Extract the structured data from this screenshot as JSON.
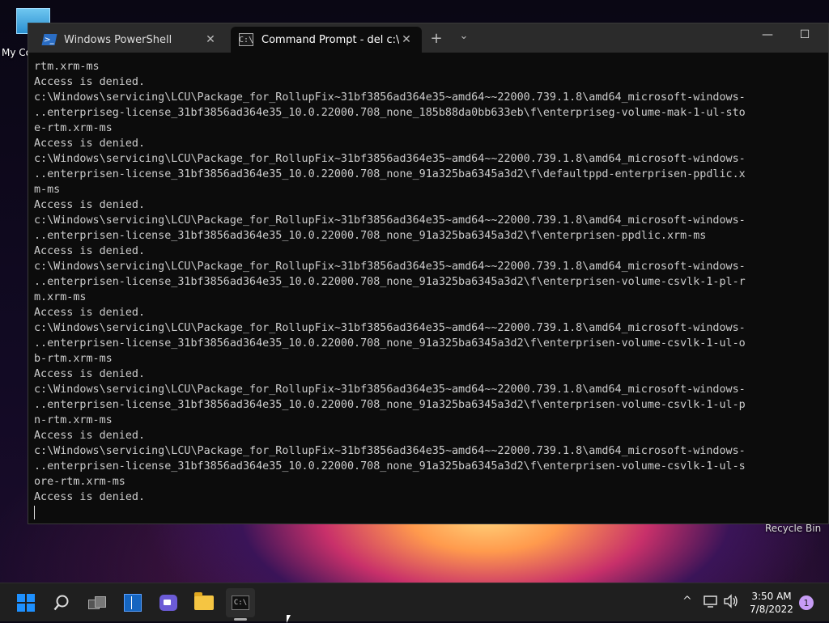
{
  "desktop": {
    "my_computer_label": "My Co",
    "recycle_bin_label": "Recycle Bin"
  },
  "window": {
    "tabs": [
      {
        "label": "Windows PowerShell",
        "icon": "powershell-icon",
        "active": false
      },
      {
        "label": "Command Prompt - del  c:\\ /s /",
        "icon": "cmd-icon",
        "active": true
      }
    ],
    "new_tab_glyph": "+",
    "dropdown_glyph": "⌄",
    "minimize_glyph": "—",
    "maximize_glyph": "☐"
  },
  "console": {
    "lines": [
      "rtm.xrm-ms",
      "Access is denied.",
      "c:\\Windows\\servicing\\LCU\\Package_for_RollupFix~31bf3856ad364e35~amd64~~22000.739.1.8\\amd64_microsoft-windows-",
      "..enterpriseg-license_31bf3856ad364e35_10.0.22000.708_none_185b88da0bb633eb\\f\\enterpriseg-volume-mak-1-ul-sto",
      "e-rtm.xrm-ms",
      "Access is denied.",
      "c:\\Windows\\servicing\\LCU\\Package_for_RollupFix~31bf3856ad364e35~amd64~~22000.739.1.8\\amd64_microsoft-windows-",
      "..enterprisen-license_31bf3856ad364e35_10.0.22000.708_none_91a325ba6345a3d2\\f\\defaultppd-enterprisen-ppdlic.x",
      "m-ms",
      "Access is denied.",
      "c:\\Windows\\servicing\\LCU\\Package_for_RollupFix~31bf3856ad364e35~amd64~~22000.739.1.8\\amd64_microsoft-windows-",
      "..enterprisen-license_31bf3856ad364e35_10.0.22000.708_none_91a325ba6345a3d2\\f\\enterprisen-ppdlic.xrm-ms",
      "Access is denied.",
      "c:\\Windows\\servicing\\LCU\\Package_for_RollupFix~31bf3856ad364e35~amd64~~22000.739.1.8\\amd64_microsoft-windows-",
      "..enterprisen-license_31bf3856ad364e35_10.0.22000.708_none_91a325ba6345a3d2\\f\\enterprisen-volume-csvlk-1-pl-r",
      "m.xrm-ms",
      "Access is denied.",
      "c:\\Windows\\servicing\\LCU\\Package_for_RollupFix~31bf3856ad364e35~amd64~~22000.739.1.8\\amd64_microsoft-windows-",
      "..enterprisen-license_31bf3856ad364e35_10.0.22000.708_none_91a325ba6345a3d2\\f\\enterprisen-volume-csvlk-1-ul-o",
      "b-rtm.xrm-ms",
      "Access is denied.",
      "c:\\Windows\\servicing\\LCU\\Package_for_RollupFix~31bf3856ad364e35~amd64~~22000.739.1.8\\amd64_microsoft-windows-",
      "..enterprisen-license_31bf3856ad364e35_10.0.22000.708_none_91a325ba6345a3d2\\f\\enterprisen-volume-csvlk-1-ul-p",
      "n-rtm.xrm-ms",
      "Access is denied.",
      "c:\\Windows\\servicing\\LCU\\Package_for_RollupFix~31bf3856ad364e35~amd64~~22000.739.1.8\\amd64_microsoft-windows-",
      "..enterprisen-license_31bf3856ad364e35_10.0.22000.708_none_91a325ba6345a3d2\\f\\enterprisen-volume-csvlk-1-ul-s",
      "ore-rtm.xrm-ms",
      "Access is denied."
    ]
  },
  "taskbar": {
    "apps": [
      "start-icon",
      "search-icon",
      "task-view-icon",
      "widgets-icon",
      "teams-chat-icon",
      "file-explorer-icon",
      "terminal-icon"
    ],
    "tray": {
      "time": "3:50 AM",
      "date": "7/8/2022",
      "notification_count": "1"
    }
  },
  "colors": {
    "console_bg": "#0c0c0c",
    "console_fg": "#cccccc",
    "titlebar": "#2b2b2b",
    "taskbar": "#1f1f1f",
    "start_blue": "#1e90ff",
    "notification_badge": "#c79cf5"
  }
}
